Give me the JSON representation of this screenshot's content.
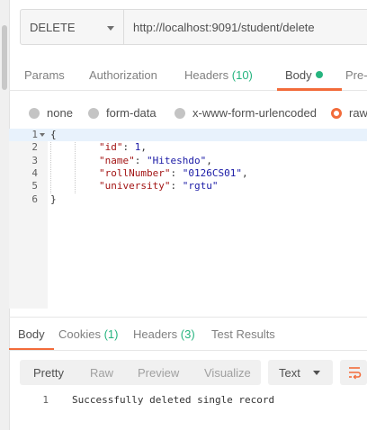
{
  "request": {
    "method": "DELETE",
    "url": "http://localhost:9091/student/delete"
  },
  "request_tabs": {
    "params": "Params",
    "authorization": "Authorization",
    "headers_label": "Headers",
    "headers_count": "(10)",
    "body": "Body",
    "pre_request": "Pre-"
  },
  "body_types": {
    "none": "none",
    "form_data": "form-data",
    "urlencoded": "x-www-form-urlencoded",
    "raw": "raw",
    "selected": "raw"
  },
  "editor": {
    "line_numbers": [
      "1",
      "2",
      "3",
      "4",
      "5",
      "6"
    ],
    "open_brace": "{",
    "close_brace": "}",
    "fields": [
      {
        "key": "\"id\"",
        "value": "1"
      },
      {
        "key": "\"name\"",
        "value": "\"Hiteshdo\""
      },
      {
        "key": "\"rollNumber\"",
        "value": "\"0126CS01\""
      },
      {
        "key": "\"university\"",
        "value": "\"rgtu\""
      }
    ]
  },
  "response_tabs": {
    "body": "Body",
    "cookies_label": "Cookies",
    "cookies_count": "(1)",
    "headers_label": "Headers",
    "headers_count": "(3)",
    "test_results": "Test Results"
  },
  "response_toolbar": {
    "pretty": "Pretty",
    "raw": "Raw",
    "preview": "Preview",
    "visualize": "Visualize",
    "format": "Text"
  },
  "response_body": {
    "line_number": "1",
    "text": "Successfully deleted single record"
  },
  "colors": {
    "accent": "#f26b3a",
    "success": "#26b47f"
  },
  "icons": {
    "method_dropdown": "chevron-down-icon",
    "fold": "fold-arrow-icon",
    "format_dropdown": "chevron-down-icon",
    "wrap": "wrap-lines-icon",
    "body_status": "dot-icon"
  }
}
